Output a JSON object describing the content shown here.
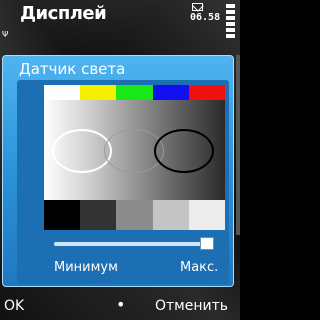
{
  "status_bar": {
    "title": "Дисплей",
    "clock": "06.58",
    "signal_label": "Ψ"
  },
  "dialog": {
    "title": "Датчик света",
    "color_bars": [
      "#ffffff",
      "#f5f000",
      "#18e818",
      "#1010f0",
      "#f01010"
    ],
    "gray_bars": [
      "#000000",
      "#333333",
      "#8c8c8c",
      "#c4c4c4",
      "#ececec"
    ],
    "slider": {
      "min_label": "Минимум",
      "max_label": "Макс.",
      "value_fraction": 1.0
    }
  },
  "softkeys": {
    "left": "OK",
    "middle": "•",
    "right": "Отменить"
  }
}
